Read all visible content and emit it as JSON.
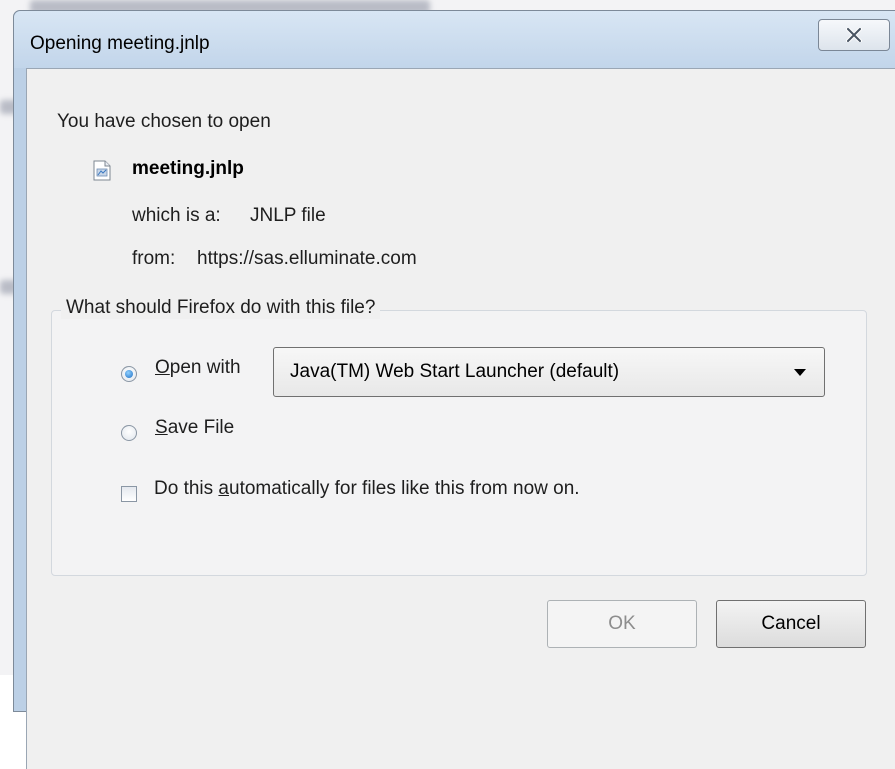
{
  "window": {
    "title": "Opening meeting.jnlp",
    "close_icon": "close-x-icon"
  },
  "dialog": {
    "intro": "You have chosen to open",
    "file": {
      "name": "meeting.jnlp",
      "icon": "document-file-icon",
      "type_label": "which is a:",
      "type_value": "JNLP file",
      "from_label": "from:",
      "from_value": "https://sas.elluminate.com"
    },
    "question": "What should Firefox do with this file?",
    "options": {
      "open_with": {
        "label_access": "O",
        "label_rest": "pen with",
        "selected": true
      },
      "save_file": {
        "label_access": "S",
        "label_rest": "ave File",
        "selected": false
      },
      "application": {
        "value": "Java(TM) Web Start Launcher (default)"
      },
      "auto": {
        "label_before": "Do this ",
        "label_access": "a",
        "label_after": "utomatically for files like this from now on.",
        "checked": false
      }
    },
    "buttons": {
      "ok": "OK",
      "cancel": "Cancel"
    }
  },
  "colors": {
    "titlebar": "#c2d5ea",
    "dialog_bg": "#f0f0f0",
    "radio_selected": "#1f6fc4"
  }
}
